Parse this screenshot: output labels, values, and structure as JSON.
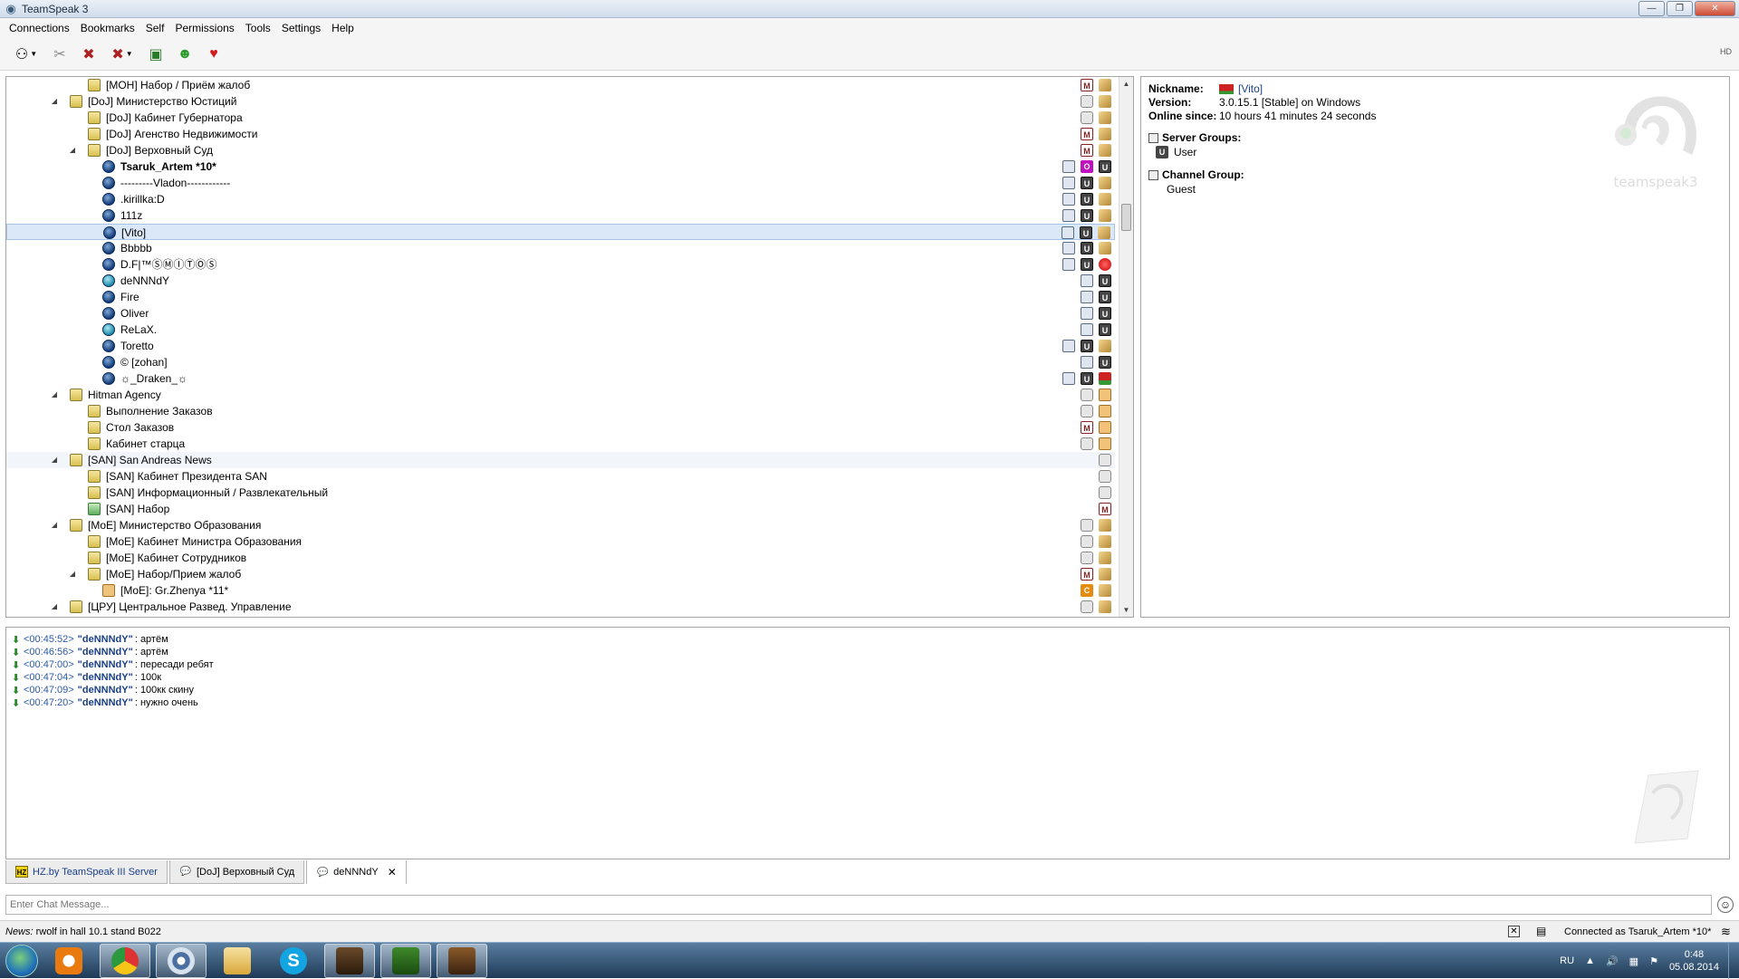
{
  "window": {
    "title": "TeamSpeak 3"
  },
  "window_buttons": {
    "minimize": "—",
    "maximize": "❐",
    "close": "✕"
  },
  "menu": [
    "Connections",
    "Bookmarks",
    "Self",
    "Permissions",
    "Tools",
    "Settings",
    "Help"
  ],
  "toolbar": {
    "buttons": [
      "connect-icon",
      "disconnect-icon",
      "mute-microphone-icon",
      "mute-speakers-icon",
      "bookmarks-icon",
      "away-icon",
      "teamspeak-icon"
    ],
    "right_label": "HD"
  },
  "tree": {
    "rows": [
      {
        "label": "[МОН] Набор / Приём жалоб",
        "type": "channel",
        "indent": 2
      },
      {
        "label": "[DoJ] Министерство Юстиций",
        "type": "channel",
        "indent": 1,
        "expanded": true
      },
      {
        "label": "[DoJ] Кабинет Губернатора",
        "type": "channel",
        "indent": 2
      },
      {
        "label": "[DoJ] Агенство Недвижимости",
        "type": "channel",
        "indent": 2
      },
      {
        "label": "[DoJ] Верховный Суд",
        "type": "channel",
        "indent": 2,
        "expanded": true
      },
      {
        "label": "Tsaruk_Artem *10*",
        "type": "client",
        "bold": true
      },
      {
        "label": "---------Vladon------------",
        "type": "client"
      },
      {
        "label": ".kirillka:D",
        "type": "client"
      },
      {
        "label": "111z",
        "type": "client"
      },
      {
        "label": "[Vito]",
        "type": "client",
        "selected": true
      },
      {
        "label": "Bbbbb",
        "type": "client"
      },
      {
        "label": "D.F|™ⓈⓂⒾⓉⓄⓈ",
        "type": "client"
      },
      {
        "label": "deNNNdY",
        "type": "client",
        "talking": true
      },
      {
        "label": "Fire",
        "type": "client"
      },
      {
        "label": "Oliver",
        "type": "client"
      },
      {
        "label": "ReLaX.",
        "type": "client",
        "talking": true
      },
      {
        "label": "Toretto",
        "type": "client"
      },
      {
        "label": "© [zohan]",
        "type": "client"
      },
      {
        "label": "☼_Draken_☼",
        "type": "client"
      },
      {
        "label": "Hitman Agency",
        "type": "channel",
        "indent": 1,
        "expanded": true
      },
      {
        "label": "Выполнение Заказов",
        "type": "channel",
        "indent": 2
      },
      {
        "label": "Стол Заказов",
        "type": "channel",
        "indent": 2
      },
      {
        "label": "Кабинет старца",
        "type": "channel",
        "indent": 2
      },
      {
        "label": "[SAN] San Andreas News",
        "type": "channel",
        "indent": 1,
        "expanded": true,
        "highlight": true
      },
      {
        "label": "[SAN] Кабинет Президента SAN",
        "type": "channel",
        "indent": 2
      },
      {
        "label": "[SAN] Информационный / Развлекательный",
        "type": "channel",
        "indent": 2
      },
      {
        "label": "[SAN] Набор",
        "type": "channel",
        "indent": 2,
        "green": true
      },
      {
        "label": "[MoE] Министерство Образования",
        "type": "channel",
        "indent": 1,
        "expanded": true
      },
      {
        "label": "[MoE] Кабинет Министра Образования",
        "type": "channel",
        "indent": 2
      },
      {
        "label": "[MoE] Кабинет Сотрудников",
        "type": "channel",
        "indent": 2
      },
      {
        "label": "[MoE] Набор/Прием жалоб",
        "type": "channel",
        "indent": 2,
        "expanded": true
      },
      {
        "label": "[MoE]: Gr.Zhenya *11*",
        "type": "client-away"
      },
      {
        "label": "[ЦРУ] Центральное Развед. Управление",
        "type": "channel",
        "indent": 1,
        "expanded": true
      }
    ]
  },
  "info": {
    "nickname_label": "Nickname:",
    "nickname": "[Vito]",
    "version_label": "Version:",
    "version": "3.0.15.1 [Stable] on Windows",
    "online_label": "Online since:",
    "online": "10 hours 41 minutes 24 seconds",
    "server_groups_label": "Server Groups:",
    "server_group": "User",
    "channel_group_label": "Channel Group:",
    "channel_group": "Guest",
    "logo_text": "teamspeak3"
  },
  "chat": {
    "messages": [
      {
        "time": "<00:45:52>",
        "sender": "\"deNNNdY\"",
        "text": ": артём"
      },
      {
        "time": "<00:46:56>",
        "sender": "\"deNNNdY\"",
        "text": ": артём"
      },
      {
        "time": "<00:47:00>",
        "sender": "\"deNNNdY\"",
        "text": ": пересади ребят"
      },
      {
        "time": "<00:47:04>",
        "sender": "\"deNNNdY\"",
        "text": ": 100к"
      },
      {
        "time": "<00:47:09>",
        "sender": "\"deNNNdY\"",
        "text": ": 100кк скину"
      },
      {
        "time": "<00:47:20>",
        "sender": "\"deNNNdY\"",
        "text": ": нужно очень"
      }
    ]
  },
  "tabs": [
    {
      "label": "HZ.by TeamSpeak III Server",
      "icon": "HZ"
    },
    {
      "label": "[DoJ] Верховный Суд",
      "icon": "💬"
    },
    {
      "label": "deNNNdY",
      "icon": "💬",
      "close": "✕",
      "active": true
    }
  ],
  "chat_input": {
    "placeholder": "Enter Chat Message..."
  },
  "status": {
    "news_label": "News:",
    "news_text": "rwolf in hall 10.1 stand B022",
    "connection": "Connected as Tsaruk_Artem *10*"
  },
  "taskbar": {
    "apps": [
      "media-player-icon",
      "chrome-icon",
      "teamspeak-icon",
      "file-explorer-icon",
      "skype-icon",
      "game-icon-1",
      "game-icon-2",
      "game-icon-3"
    ],
    "lang": "RU",
    "time": "0:48",
    "date": "05.08.2014"
  }
}
